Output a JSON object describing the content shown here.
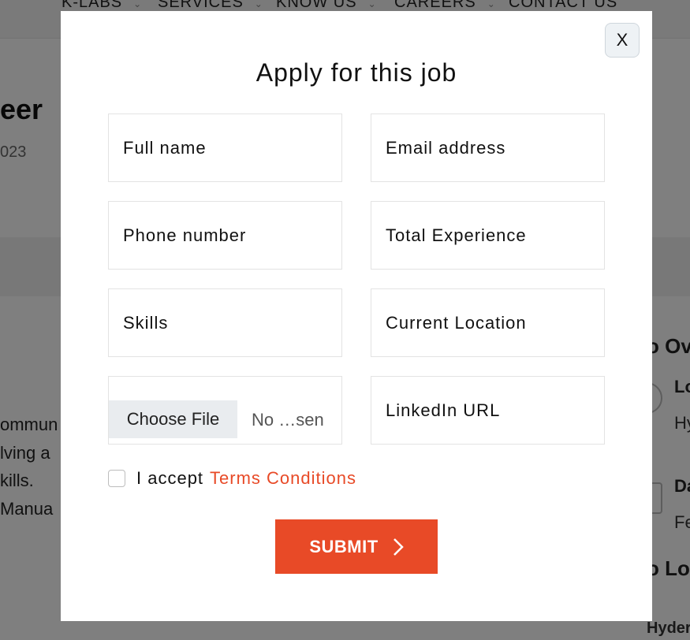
{
  "background": {
    "nav": [
      {
        "label": "K-LABS"
      },
      {
        "label": "SERVICES"
      },
      {
        "label": "KNOW US"
      },
      {
        "label": "CAREERS"
      },
      {
        "label": "CONTACT US"
      }
    ],
    "job_title_fragment": "eer",
    "date_fragment": "023",
    "body_lines": [
      "ommun",
      "lving a",
      "kills.",
      " Manua"
    ],
    "sidebar": {
      "heading1_fragment": "o Ov",
      "label1_fragment": "Lo",
      "value1_fragment": "Hy",
      "label2_fragment": "Da",
      "value2_fragment": "Fe",
      "heading2_fragment": "o Lo",
      "map_label_fragment": "Hyder"
    }
  },
  "modal": {
    "close_label": "X",
    "title": "Apply for this job",
    "fields": {
      "full_name": "Full name",
      "email": "Email address",
      "phone": "Phone number",
      "experience": "Total Experience",
      "skills": "Skills",
      "location": "Current Location",
      "linkedin": "LinkedIn URL"
    },
    "file": {
      "button_label": "Choose File",
      "status": "No …sen"
    },
    "terms": {
      "text": "I accept",
      "link": "Terms Conditions"
    },
    "submit_label": "SUBMIT"
  },
  "colors": {
    "accent": "#e84a27",
    "overlay": "rgba(0,0,0,0.5)"
  }
}
